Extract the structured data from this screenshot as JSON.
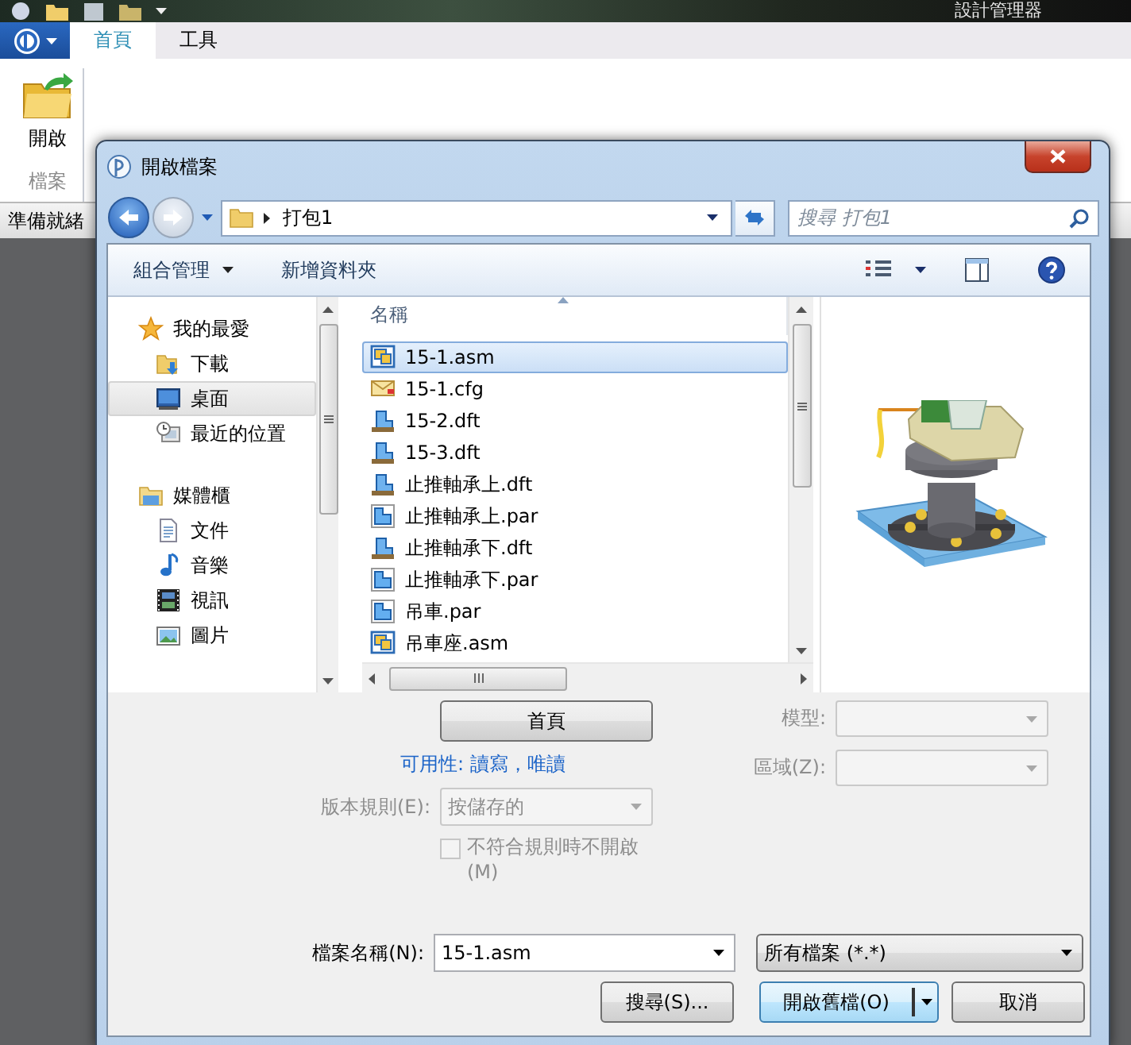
{
  "desktop_title": "設計管理器",
  "ribbon": {
    "tabs": [
      {
        "label": "首頁",
        "selected": true
      },
      {
        "label": "工具",
        "selected": false
      }
    ],
    "open_button": "開啟",
    "group_label": "檔案"
  },
  "status_bar": "準備就緒",
  "dialog": {
    "title": "開啟檔案",
    "path": [
      "打包1"
    ],
    "search": {
      "placeholder": "搜尋 打包1"
    },
    "toolbar": {
      "organize": "組合管理",
      "new_folder": "新增資料夾"
    },
    "nav": [
      {
        "label": "我的最愛",
        "kind": "favorites",
        "selected": false,
        "children": [
          {
            "label": "下載",
            "kind": "downloads",
            "selected": false
          },
          {
            "label": "桌面",
            "kind": "desktop",
            "selected": true
          },
          {
            "label": "最近的位置",
            "kind": "recent",
            "selected": false
          }
        ]
      },
      {
        "label": "媒體櫃",
        "kind": "libraries",
        "selected": false,
        "children": [
          {
            "label": "文件",
            "kind": "documents",
            "selected": false
          },
          {
            "label": "音樂",
            "kind": "music",
            "selected": false
          },
          {
            "label": "視訊",
            "kind": "video",
            "selected": false
          },
          {
            "label": "圖片",
            "kind": "pictures",
            "selected": false
          }
        ]
      }
    ],
    "list": {
      "columns": [
        "名稱"
      ],
      "files": [
        {
          "name": "15-1.asm",
          "kind": "asm",
          "selected": true
        },
        {
          "name": "15-1.cfg",
          "kind": "cfg",
          "selected": false
        },
        {
          "name": "15-2.dft",
          "kind": "dft",
          "selected": false
        },
        {
          "name": "15-3.dft",
          "kind": "dft",
          "selected": false
        },
        {
          "name": "止推軸承上.dft",
          "kind": "dft",
          "selected": false
        },
        {
          "name": "止推軸承上.par",
          "kind": "par",
          "selected": false
        },
        {
          "name": "止推軸承下.dft",
          "kind": "dft",
          "selected": false
        },
        {
          "name": "止推軸承下.par",
          "kind": "par",
          "selected": false
        },
        {
          "name": "吊車.par",
          "kind": "par",
          "selected": false
        },
        {
          "name": "吊車座.asm",
          "kind": "asm",
          "selected": false
        }
      ]
    },
    "home_button": "首頁",
    "availability": "可用性: 讀寫，唯讀",
    "version_rule": {
      "label": "版本規則(E):",
      "value": "按儲存的",
      "disabled": true
    },
    "no_open_checkbox": {
      "label": "不符合規則時不開啟(M)",
      "checked": false,
      "disabled": true
    },
    "model": {
      "label": "模型:",
      "disabled": true
    },
    "zone": {
      "label": "區域(Z):",
      "disabled": true
    },
    "file_name": {
      "label": "檔案名稱(N):",
      "value": "15-1.asm"
    },
    "file_type": "所有檔案 (*.*)",
    "buttons": [
      {
        "label": "搜尋(S)...",
        "kind": "plain"
      },
      {
        "label": "開啟舊檔(O)",
        "kind": "split"
      },
      {
        "label": "取消",
        "kind": "plain"
      }
    ]
  }
}
